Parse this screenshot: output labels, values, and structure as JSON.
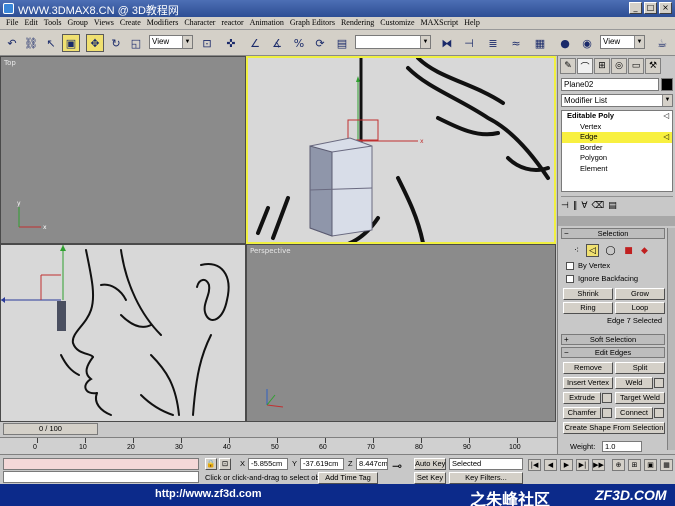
{
  "titlebar": {
    "text": "WWW.3DMAX8.CN @ 3D教程网"
  },
  "menu": [
    "File",
    "Edit",
    "Tools",
    "Group",
    "Views",
    "Create",
    "Modifiers",
    "Character",
    "reactor",
    "Animation",
    "Graph Editors",
    "Rendering",
    "Customize",
    "MAXScript",
    "Help"
  ],
  "toolbar": {
    "view_dropdown": "View",
    "view_dropdown_right": "View",
    "named_selection": ""
  },
  "viewports": {
    "top": "Top",
    "perspective": "Perspective"
  },
  "panel": {
    "object_name": "Plane02",
    "modifier_list": "Modifier List",
    "stack": [
      "Editable Poly",
      "Vertex",
      "Edge",
      "Border",
      "Polygon",
      "Element"
    ],
    "selection": {
      "title": "Selection",
      "by_vertex": "By Vertex",
      "ignore_backfacing": "Ignore Backfacing",
      "shrink": "Shrink",
      "grow": "Grow",
      "ring": "Ring",
      "loop": "Loop",
      "status": "Edge 7 Selected"
    },
    "soft_selection": {
      "title": "Soft Selection"
    },
    "edit_edges": {
      "title": "Edit Edges",
      "remove": "Remove",
      "split": "Split",
      "insert_vertex": "Insert Vertex",
      "weld": "Weld",
      "extrude": "Extrude",
      "target_weld": "Target Weld",
      "chamfer": "Chamfer",
      "connect": "Connect",
      "create_shape": "Create Shape From Selection",
      "weight_label": "Weight:",
      "weight_value": "1.0"
    }
  },
  "timeline": {
    "frame": "0 / 100",
    "ticks": [
      "0",
      "10",
      "20",
      "30",
      "40",
      "50",
      "60",
      "70",
      "80",
      "90",
      "100"
    ]
  },
  "status": {
    "prompt": "Click or click-and-drag to select ob",
    "add_time_tag": "Add Time Tag",
    "x_label": "X",
    "x_value": "-5.855cm",
    "y_label": "Y",
    "y_value": "-37.619cm",
    "z_label": "Z",
    "z_value": "8.447cm",
    "auto_key": "Auto Key",
    "set_key": "Set Key",
    "selected": "Selected",
    "key_filters": "Key Filters..."
  },
  "banner": {
    "url": "http://www.zf3d.com",
    "cn": "之朱峰社区",
    "logo": "ZF3D.COM"
  }
}
